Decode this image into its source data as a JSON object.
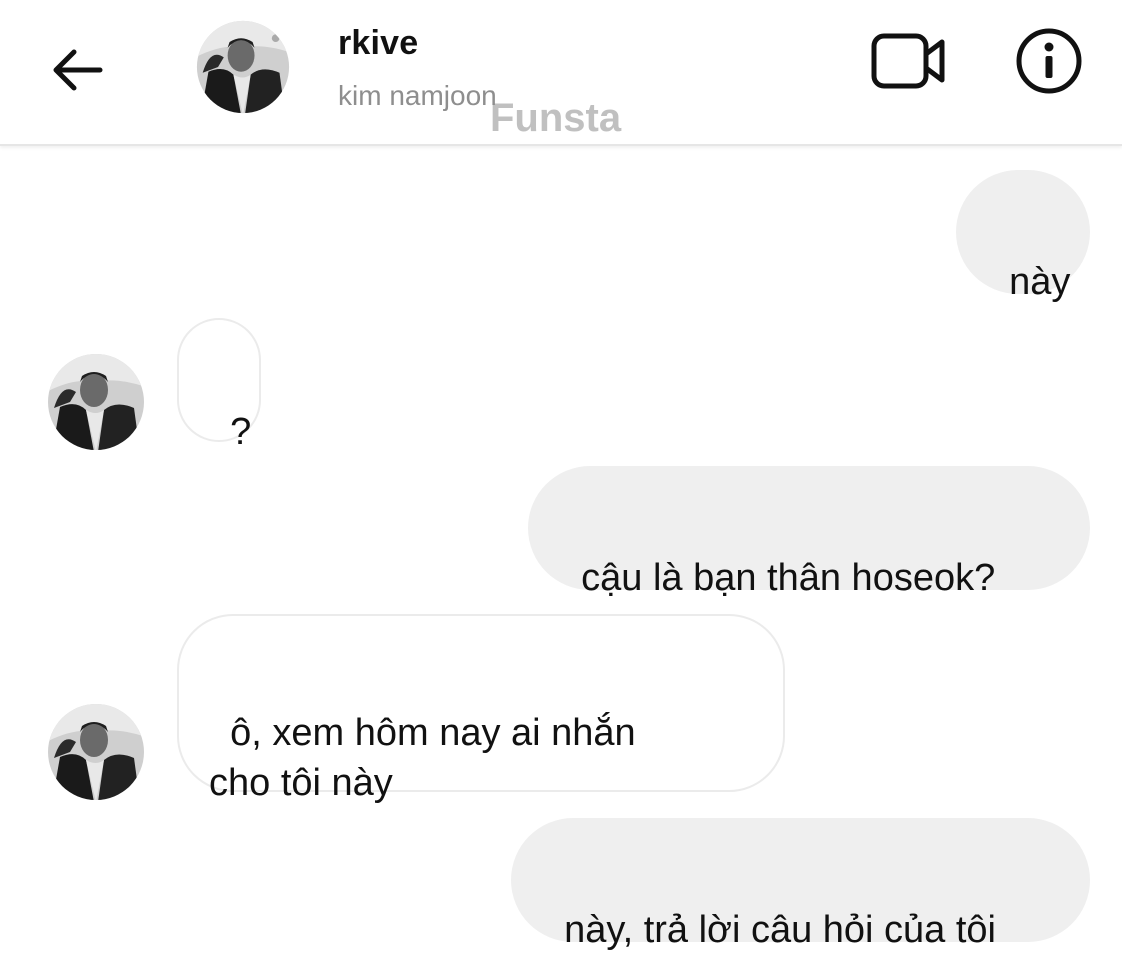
{
  "header": {
    "title": "rkive",
    "subtitle": "kim namjoon",
    "watermark": "Funsta",
    "back_icon": "arrow-left-icon",
    "video_icon": "video-camera-icon",
    "info_icon": "info-icon"
  },
  "messages": [
    {
      "direction": "sent",
      "text": "này"
    },
    {
      "direction": "received",
      "text": "?"
    },
    {
      "direction": "sent",
      "text": "cậu là bạn thân hoseok?"
    },
    {
      "direction": "received",
      "text": "ô, xem hôm nay ai nhắn\ncho tôi này"
    },
    {
      "direction": "sent",
      "text": "này, trả lời câu hỏi của tôi"
    }
  ],
  "colors": {
    "sent_bubble": "#efefef",
    "received_border": "#ebebeb",
    "subtitle": "#8e8e8e"
  }
}
